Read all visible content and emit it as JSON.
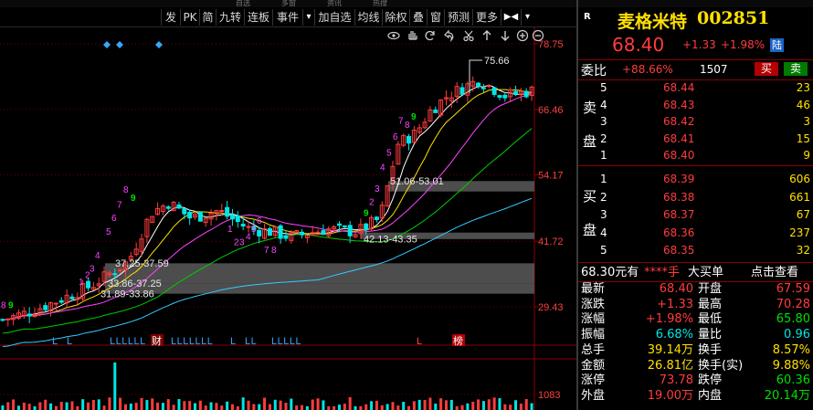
{
  "top_strip": [
    "自选",
    "多窗",
    "资讯",
    "热搜"
  ],
  "toolbar": {
    "items": [
      "发",
      "PK",
      "简",
      "九转",
      "连板",
      "事件",
      "▾",
      "加自选",
      "均线",
      "除权",
      "叠",
      "窗",
      "预测",
      "更多",
      "▶◀",
      "▾"
    ]
  },
  "chart": {
    "type": "candlestick",
    "price_axis": [
      "78.75",
      "66.46",
      "54.17",
      "41.72",
      "29.43"
    ],
    "volume_axis": "1083",
    "max_price_label": "75.66",
    "zone_labels": [
      "51.06-53.01",
      "42.13-43.35",
      "37.25-37.59",
      "33.86-37.25",
      "31.89-33.86"
    ],
    "bottom_markers": [
      "L",
      "L",
      "LLLLLL",
      "财",
      "LLLLLLL",
      "L",
      "LL",
      "LLLLL",
      "L",
      "榜"
    ],
    "sequence_numbers": [
      "8",
      "9",
      "1",
      "2",
      "3",
      "4",
      "5",
      "6",
      "7",
      "8",
      "9",
      "1",
      "2",
      "3",
      "4",
      "5",
      "6",
      "7",
      "8",
      "9",
      "2",
      "3",
      "4",
      "5",
      "6",
      "7",
      "8",
      "9",
      "1",
      "2",
      "3",
      "4",
      "5",
      "6",
      "7",
      "8",
      "9"
    ]
  },
  "quote": {
    "market_flag": "R",
    "name": "麦格米特",
    "code": "002851",
    "price": "68.40",
    "change": "+1.33",
    "change_pct": "+1.98%",
    "badge": "陆",
    "wei_label": "委比",
    "wei_value": "+88.66%",
    "wei_count": "1507",
    "buy_btn": "买",
    "sell_btn": "卖"
  },
  "order_book": {
    "sell_label": [
      "卖",
      "盘"
    ],
    "buy_label": [
      "买",
      "盘"
    ],
    "sells": [
      {
        "level": "5",
        "price": "68.44",
        "vol": "23"
      },
      {
        "level": "4",
        "price": "68.43",
        "vol": "46"
      },
      {
        "level": "3",
        "price": "68.42",
        "vol": "3"
      },
      {
        "level": "2",
        "price": "68.41",
        "vol": "15"
      },
      {
        "level": "1",
        "price": "68.40",
        "vol": "9"
      }
    ],
    "buys": [
      {
        "level": "1",
        "price": "68.39",
        "vol": "606"
      },
      {
        "level": "2",
        "price": "68.38",
        "vol": "661"
      },
      {
        "level": "3",
        "price": "68.37",
        "vol": "67"
      },
      {
        "level": "4",
        "price": "68.36",
        "vol": "237"
      },
      {
        "level": "5",
        "price": "68.35",
        "vol": "32"
      }
    ]
  },
  "big_order": {
    "price_text": "68.30元有",
    "hidden_vol": "****手",
    "label": "大买单",
    "link": "点击查看"
  },
  "stats": [
    {
      "l": "最新",
      "v": "68.40",
      "vc": "red",
      "l2": "开盘",
      "v2": "67.59",
      "v2c": "red"
    },
    {
      "l": "涨跌",
      "v": "+1.33",
      "vc": "red",
      "l2": "最高",
      "v2": "70.28",
      "v2c": "red"
    },
    {
      "l": "涨幅",
      "v": "+1.98%",
      "vc": "red",
      "l2": "最低",
      "v2": "65.80",
      "v2c": "green"
    },
    {
      "l": "振幅",
      "v": "6.68%",
      "vc": "cyan",
      "l2": "量比",
      "v2": "0.96",
      "v2c": "cyan"
    },
    {
      "l": "总手",
      "v": "39.14万",
      "vc": "yellow",
      "l2": "换手",
      "v2": "8.57%",
      "v2c": "yellow"
    },
    {
      "l": "金额",
      "v": "26.81亿",
      "vc": "yellow",
      "l2": "换手(实)",
      "v2": "9.88%",
      "v2c": "yellow"
    },
    {
      "l": "涨停",
      "v": "73.78",
      "vc": "red",
      "l2": "跌停",
      "v2": "60.36",
      "v2c": "green"
    },
    {
      "l": "外盘",
      "v": "19.00万",
      "vc": "red",
      "l2": "内盘",
      "v2": "20.14万",
      "v2c": "green"
    }
  ],
  "colors": {
    "up": "#ff3c3c",
    "down": "#00e5e5",
    "ma5": "#ffffff",
    "ma10": "#ffe000",
    "ma20": "#ff44ff",
    "ma30": "#00cc00",
    "ma60": "#33ccff",
    "zone": "#5a5a5a"
  }
}
